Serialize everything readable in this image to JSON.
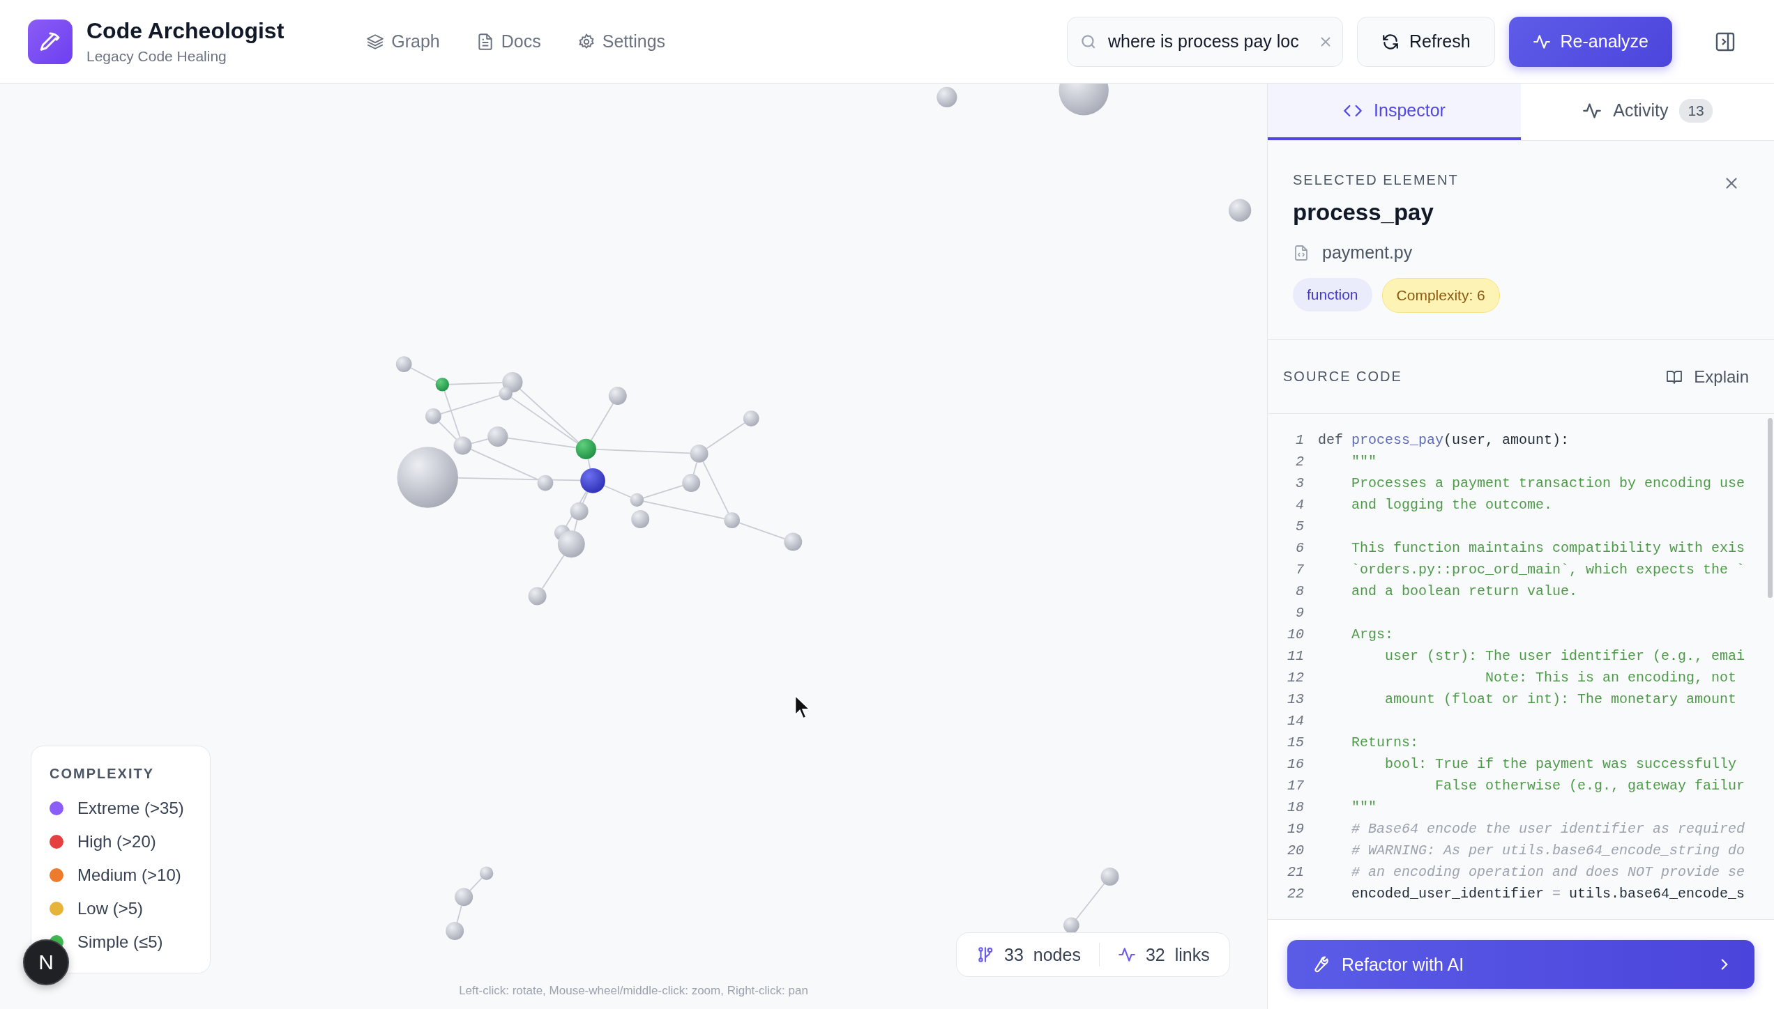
{
  "header": {
    "title": "Code Archeologist",
    "subtitle": "Legacy Code Healing",
    "nav": [
      {
        "label": "Graph",
        "kind": "layers"
      },
      {
        "label": "Docs",
        "kind": "file"
      },
      {
        "label": "Settings",
        "kind": "gear"
      }
    ],
    "search": {
      "value": "where is process pay loc"
    },
    "buttons": [
      {
        "label": "Refresh",
        "kind": "secondary"
      },
      {
        "label": "Re-analyze",
        "kind": "primary"
      }
    ]
  },
  "legend": {
    "title": "COMPLEXITY",
    "items": [
      {
        "label": "Extreme (>35)",
        "color": "#8b5cf6"
      },
      {
        "label": "High (>20)",
        "color": "#e5403f"
      },
      {
        "label": "Medium (>10)",
        "color": "#ee7a2c"
      },
      {
        "label": "Low (>5)",
        "color": "#e7b43a"
      },
      {
        "label": "Simple (≤5)",
        "color": "#3fb950"
      }
    ]
  },
  "dev_badge": "N",
  "stats": [
    {
      "count": "33",
      "label": "nodes",
      "kind": "nodes"
    },
    {
      "count": "32",
      "label": "links",
      "kind": "links"
    }
  ],
  "hint": "Left-click: rotate, Mouse-wheel/middle-click: zoom, Right-click: pan",
  "panel": {
    "tabs": [
      {
        "label": "Inspector",
        "kind": "code",
        "selected": true
      },
      {
        "label": "Activity",
        "kind": "activity",
        "count": "13",
        "selected": false
      }
    ],
    "selected": {
      "heading": "SELECTED ELEMENT",
      "name": "process_pay",
      "file": "payment.py",
      "tags": [
        {
          "label": "function",
          "kind": "type"
        },
        {
          "label": "Complexity: 6",
          "kind": "complexity"
        }
      ]
    },
    "source": {
      "heading": "SOURCE CODE",
      "action": "Explain",
      "lines": [
        {
          "number": "1",
          "segments": [
            {
              "text": "def ",
              "kind": "kw"
            },
            {
              "text": "process_pay",
              "kind": "fn"
            },
            {
              "text": "(user, amount):",
              "kind": "plain"
            }
          ]
        },
        {
          "number": "2",
          "segments": [
            {
              "text": "    \"\"\"",
              "kind": "doc"
            }
          ]
        },
        {
          "number": "3",
          "segments": [
            {
              "text": "    Processes a payment transaction by encoding use",
              "kind": "doc"
            }
          ]
        },
        {
          "number": "4",
          "segments": [
            {
              "text": "    and logging the outcome.",
              "kind": "doc"
            }
          ]
        },
        {
          "number": "5"
        },
        {
          "number": "6",
          "segments": [
            {
              "text": "    This function maintains compatibility with exis",
              "kind": "doc"
            }
          ]
        },
        {
          "number": "7",
          "segments": [
            {
              "text": "    `orders.py::proc_ord_main`, which expects the `",
              "kind": "doc"
            }
          ]
        },
        {
          "number": "8",
          "segments": [
            {
              "text": "    and a boolean return value.",
              "kind": "doc"
            }
          ]
        },
        {
          "number": "9"
        },
        {
          "number": "10",
          "segments": [
            {
              "text": "    Args:",
              "kind": "doc"
            }
          ]
        },
        {
          "number": "11",
          "segments": [
            {
              "text": "        user (str): The user identifier (e.g., emai",
              "kind": "doc"
            }
          ]
        },
        {
          "number": "12",
          "segments": [
            {
              "text": "                    Note: This is an encoding, not",
              "kind": "doc"
            }
          ]
        },
        {
          "number": "13",
          "segments": [
            {
              "text": "        amount (float or int): The monetary amount",
              "kind": "doc"
            }
          ]
        },
        {
          "number": "14"
        },
        {
          "number": "15",
          "segments": [
            {
              "text": "    Returns:",
              "kind": "doc"
            }
          ]
        },
        {
          "number": "16",
          "segments": [
            {
              "text": "        bool: True if the payment was successfully",
              "kind": "doc"
            }
          ]
        },
        {
          "number": "17",
          "segments": [
            {
              "text": "              False otherwise (e.g., gateway failur",
              "kind": "doc"
            }
          ]
        },
        {
          "number": "18",
          "segments": [
            {
              "text": "    \"\"\"",
              "kind": "doc"
            }
          ]
        },
        {
          "number": "19",
          "segments": [
            {
              "text": "    # Base64 encode the user identifier as required",
              "kind": "comment"
            }
          ]
        },
        {
          "number": "20",
          "segments": [
            {
              "text": "    # WARNING: As per utils.base64_encode_string do",
              "kind": "comment"
            }
          ]
        },
        {
          "number": "21",
          "segments": [
            {
              "text": "    # an encoding operation and does NOT provide se",
              "kind": "comment"
            }
          ]
        },
        {
          "number": "22",
          "segments": [
            {
              "text": "    encoded_user_identifier ",
              "kind": "plain"
            },
            {
              "text": "=",
              "kind": "op"
            },
            {
              "text": " utils.base64_encode_s",
              "kind": "plain"
            }
          ]
        }
      ]
    },
    "refactor_button": "Refactor with AI"
  }
}
